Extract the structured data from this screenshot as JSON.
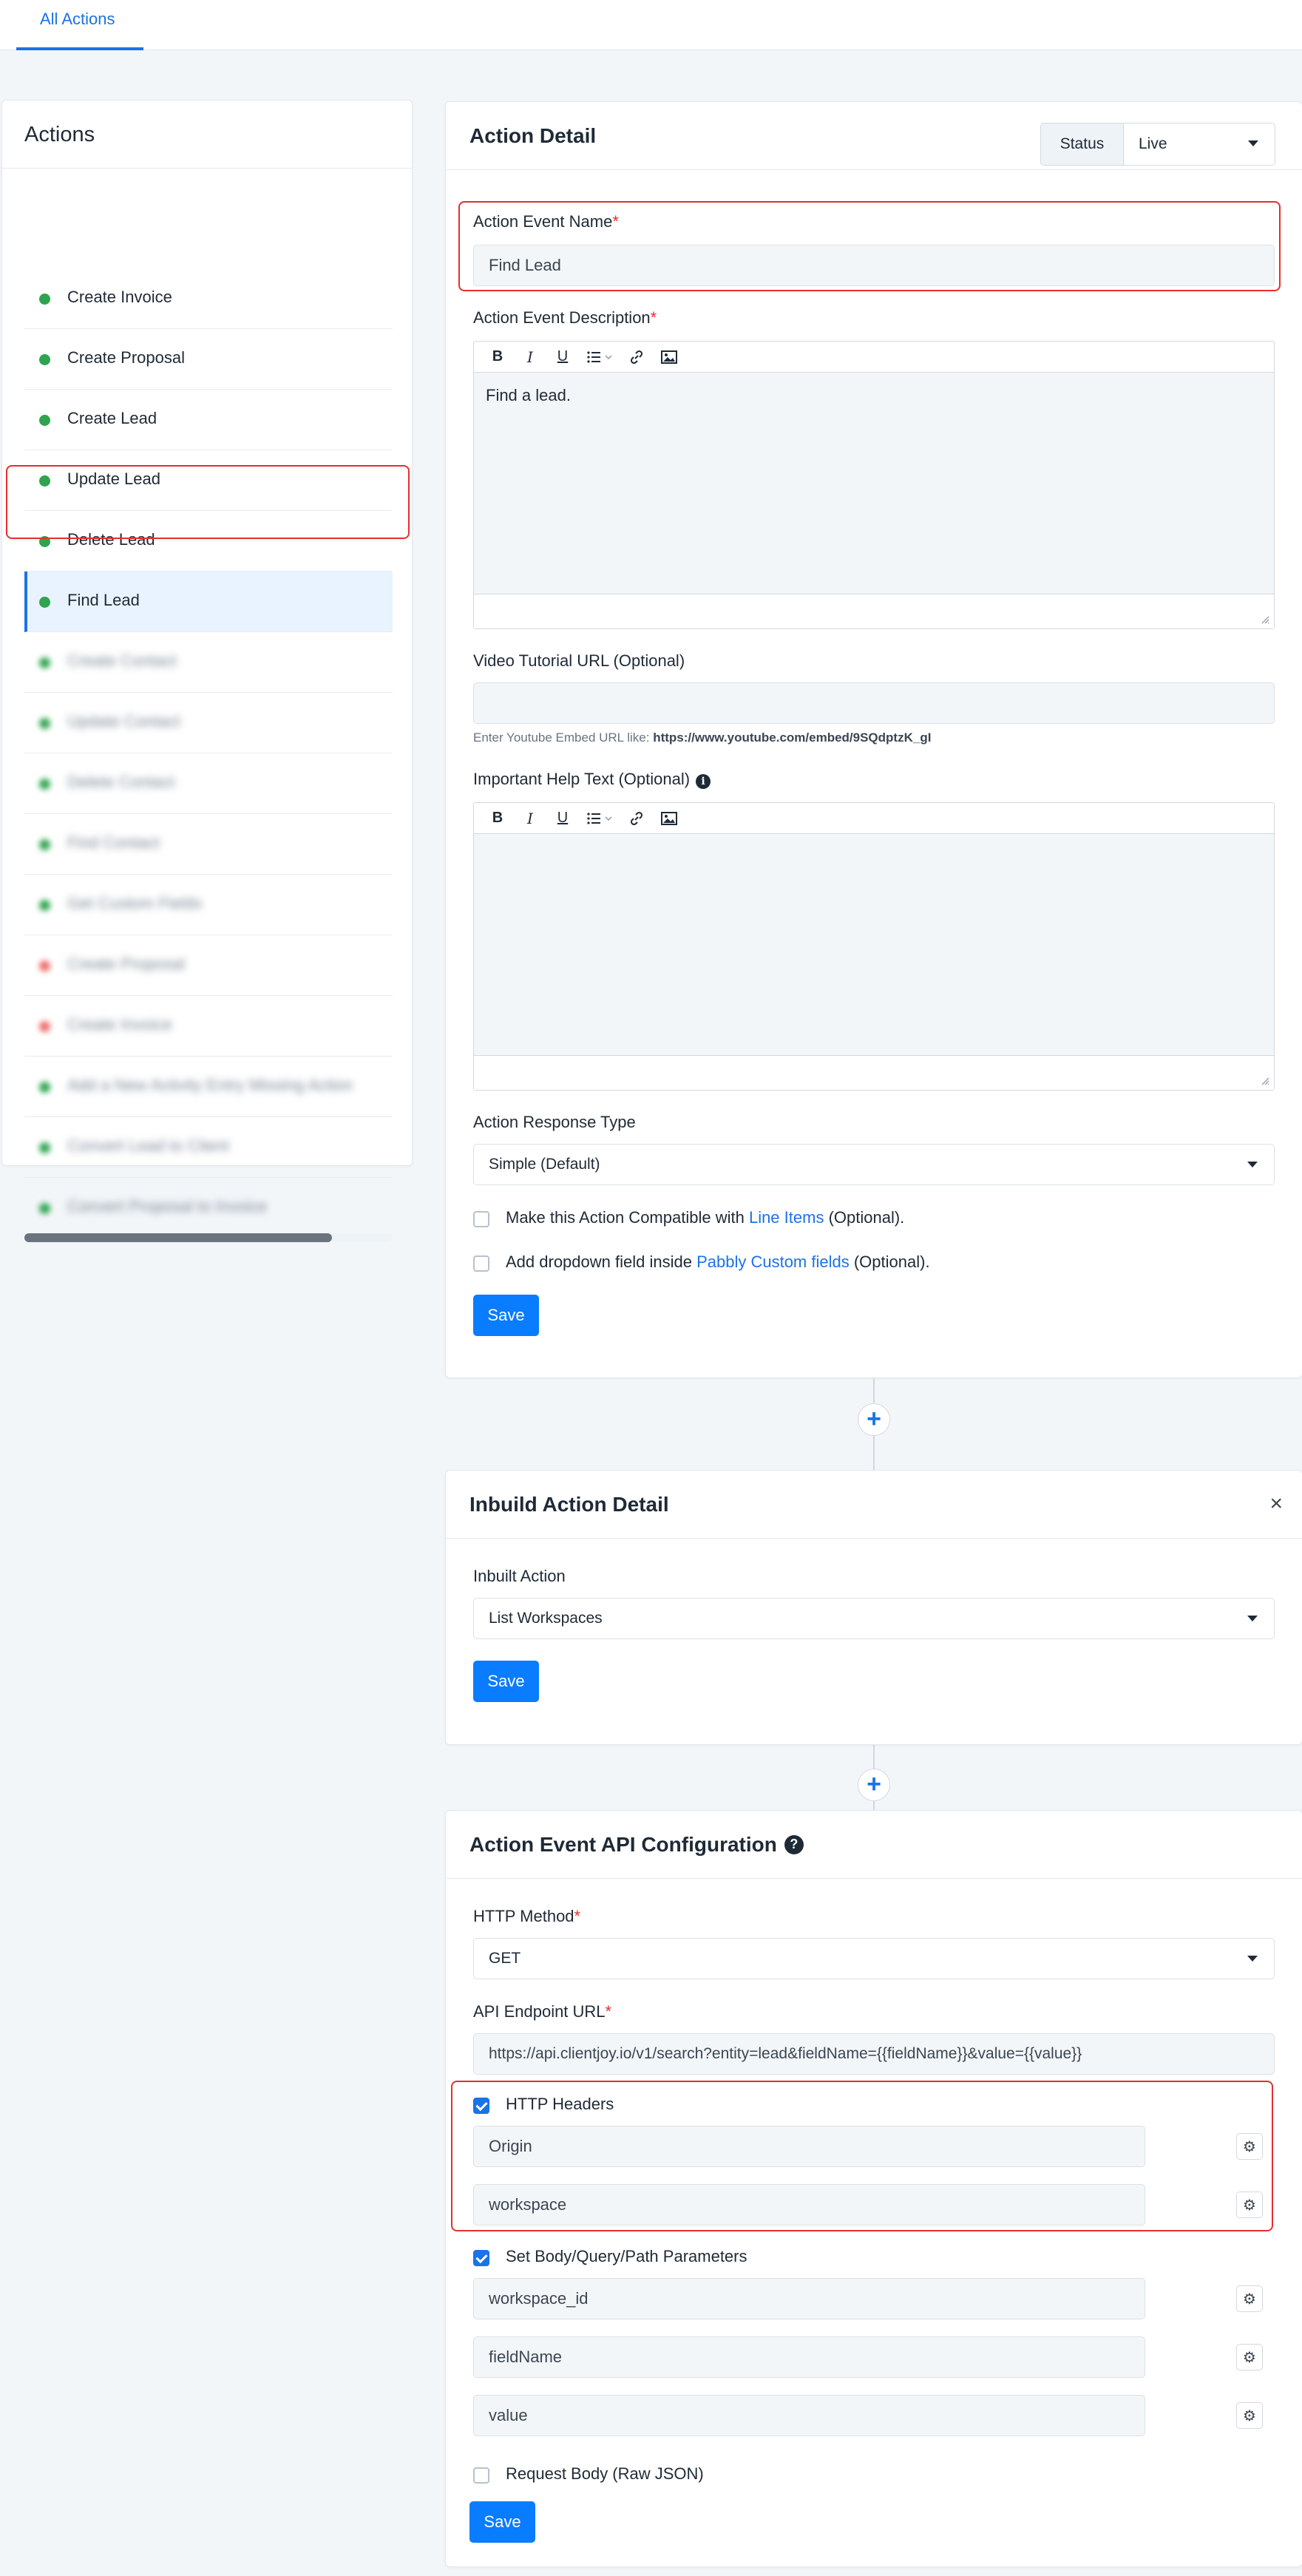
{
  "topbar": {
    "tab_label": "All Actions"
  },
  "sidebar": {
    "title": "Actions",
    "items": [
      {
        "label": "Create Invoice",
        "status": "green"
      },
      {
        "label": "Create Proposal",
        "status": "green"
      },
      {
        "label": "Create Lead",
        "status": "green"
      },
      {
        "label": "Update Lead",
        "status": "green"
      },
      {
        "label": "Delete Lead",
        "status": "green"
      },
      {
        "label": "Find Lead",
        "status": "green",
        "active": true
      },
      {
        "label": "Create Contact",
        "status": "green",
        "blurred": true
      },
      {
        "label": "Update Contact",
        "status": "green",
        "blurred": true
      },
      {
        "label": "Delete Contact",
        "status": "green",
        "blurred": true
      },
      {
        "label": "Find Contact",
        "status": "green",
        "blurred": true
      },
      {
        "label": "Get Custom Fields",
        "status": "green",
        "blurred": true
      },
      {
        "label": "Create Proposal",
        "status": "red",
        "blurred": true
      },
      {
        "label": "Create Invoice",
        "status": "red",
        "blurred": true
      },
      {
        "label": "Add a New Activity Entry Missing Action",
        "status": "green",
        "blurred": true
      },
      {
        "label": "Convert Lead to Client",
        "status": "green",
        "blurred": true
      },
      {
        "label": "Convert Proposal to Invoice",
        "status": "green",
        "blurred": true
      }
    ]
  },
  "action_detail": {
    "title": "Action Detail",
    "status_label": "Status",
    "status_value": "Live",
    "event_name_label": "Action Event Name",
    "event_name_value": "Find Lead",
    "event_desc_label": "Action Event Description",
    "event_desc_value": "Find a lead.",
    "video_label": "Video Tutorial URL (Optional)",
    "video_value": "",
    "video_hint_prefix": "Enter Youtube Embed URL like:",
    "video_hint_url": "https://www.youtube.com/embed/9SQdptzK_gI",
    "help_label": "Important Help Text (Optional)",
    "response_type_label": "Action Response Type",
    "response_type_value": "Simple (Default)",
    "line_items_prefix": "Make this Action Compatible with",
    "line_items_link": "Line Items",
    "line_items_suffix": "(Optional).",
    "dropdown_prefix": "Add dropdown field inside",
    "dropdown_link": "Pabbly Custom fields",
    "dropdown_suffix": "(Optional).",
    "save_label": "Save"
  },
  "editor_tools": {
    "bold": "B",
    "italic": "I",
    "underline": "U"
  },
  "inbuild": {
    "title": "Inbuild Action Detail",
    "close": "×",
    "inbuilt_label": "Inbuilt Action",
    "inbuilt_value": "List Workspaces",
    "save_label": "Save"
  },
  "api_config": {
    "title": "Action Event API Configuration",
    "method_label": "HTTP Method",
    "method_value": "GET",
    "endpoint_label": "API Endpoint URL",
    "endpoint_value": "https://api.clientjoy.io/v1/search?entity=lead&fieldName={{fieldName}}&value={{value}}",
    "headers_label": "HTTP Headers",
    "headers": [
      "Origin",
      "workspace"
    ],
    "params_label": "Set Body/Query/Path Parameters",
    "params": [
      "workspace_id",
      "fieldName",
      "value"
    ],
    "raw_json_label": "Request Body (Raw JSON)",
    "save_label": "Save"
  },
  "colors": {
    "accent": "#0a7cff",
    "highlight": "#e52e2e",
    "status_green": "#2ea44f",
    "status_red": "#ef6b6b"
  }
}
